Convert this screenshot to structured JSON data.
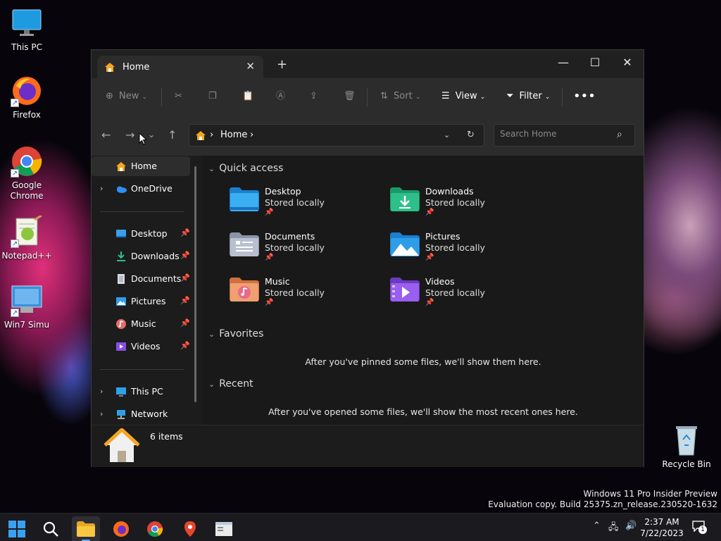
{
  "desktop": {
    "icons": [
      {
        "label": "This PC"
      },
      {
        "label": "Firefox"
      },
      {
        "label": "Google Chrome"
      },
      {
        "label": "Notepad++"
      },
      {
        "label": "Win7 Simu"
      },
      {
        "label": "Recycle Bin"
      }
    ]
  },
  "explorer": {
    "tab": {
      "title": "Home"
    },
    "toolbar": {
      "new_label": "New",
      "sort_label": "Sort",
      "view_label": "View",
      "filter_label": "Filter"
    },
    "address": {
      "crumb": "Home"
    },
    "search": {
      "placeholder": "Search Home"
    },
    "sidebar": {
      "items": [
        {
          "label": "Home"
        },
        {
          "label": "OneDrive"
        },
        {
          "label": "Desktop"
        },
        {
          "label": "Downloads"
        },
        {
          "label": "Documents"
        },
        {
          "label": "Pictures"
        },
        {
          "label": "Music"
        },
        {
          "label": "Videos"
        },
        {
          "label": "This PC"
        },
        {
          "label": "Network"
        }
      ]
    },
    "quick_access": {
      "title": "Quick access",
      "items": [
        {
          "name": "Desktop",
          "sub": "Stored locally"
        },
        {
          "name": "Downloads",
          "sub": "Stored locally"
        },
        {
          "name": "Documents",
          "sub": "Stored locally"
        },
        {
          "name": "Pictures",
          "sub": "Stored locally"
        },
        {
          "name": "Music",
          "sub": "Stored locally"
        },
        {
          "name": "Videos",
          "sub": "Stored locally"
        }
      ]
    },
    "favorites": {
      "title": "Favorites",
      "message": "After you've pinned some files, we'll show them here."
    },
    "recent": {
      "title": "Recent",
      "message": "After you've opened some files, we'll show the most recent ones here."
    },
    "status": {
      "items_count": "6 items"
    }
  },
  "watermark": {
    "line1": "Windows 11 Pro Insider Preview",
    "line2": "Evaluation copy. Build 25375.zn_release.230520-1632"
  },
  "taskbar": {
    "time": "2:37 AM",
    "date": "7/22/2023",
    "notification_count": "1"
  },
  "colors": {
    "accent": "#5aa9ff",
    "window_bg": "#1c1c1c",
    "toolbar_bg": "#2c2c2c"
  }
}
